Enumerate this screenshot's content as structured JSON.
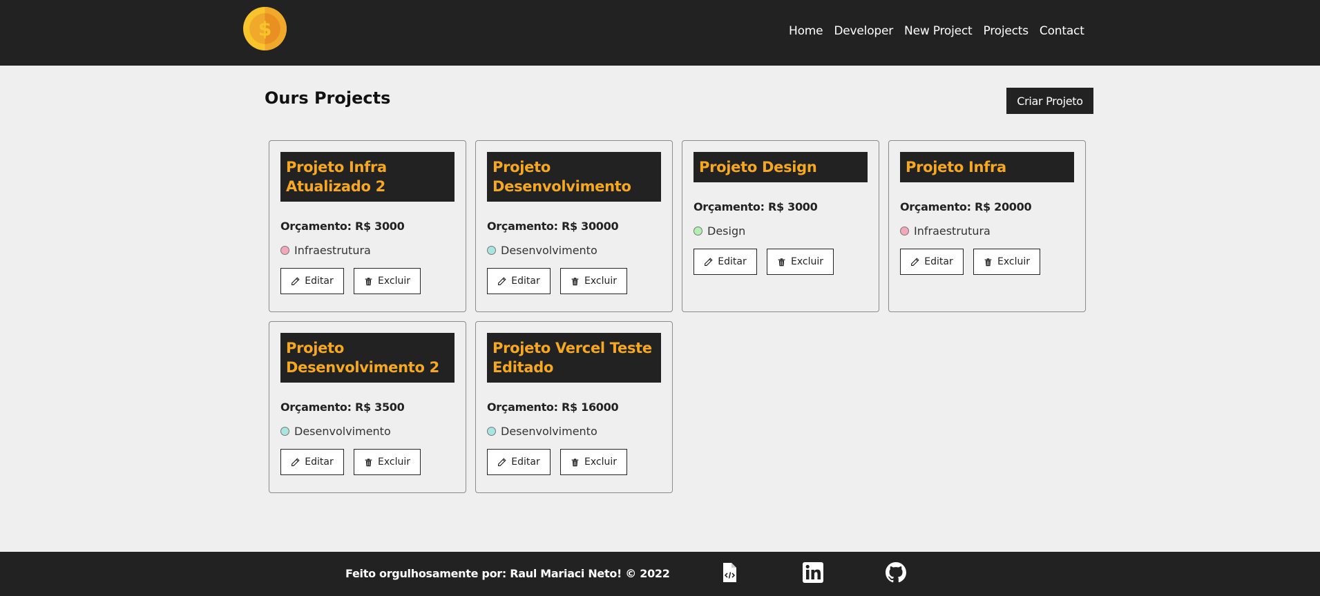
{
  "header": {
    "logo_icon": "coin-dollar-icon",
    "nav": [
      "Home",
      "Developer",
      "New Project",
      "Projects",
      "Contact"
    ]
  },
  "main": {
    "title": "Ours Projects",
    "create_button": "Criar Projeto"
  },
  "projects": [
    {
      "name": "Projeto Infra Atualizado 2",
      "budget": "Orçamento: R$ 3000",
      "category": "Infraestrutura",
      "category_color": "#f4a7b9"
    },
    {
      "name": "Projeto Desenvolvimento",
      "budget": "Orçamento: R$ 30000",
      "category": "Desenvolvimento",
      "category_color": "#a8e4e0"
    },
    {
      "name": "Projeto Design",
      "budget": "Orçamento: R$ 3000",
      "category": "Design",
      "category_color": "#b2efb2"
    },
    {
      "name": "Projeto Infra",
      "budget": "Orçamento: R$ 20000",
      "category": "Infraestrutura",
      "category_color": "#f4a7b9"
    },
    {
      "name": "Projeto Desenvolvimento 2",
      "budget": "Orçamento: R$ 3500",
      "category": "Desenvolvimento",
      "category_color": "#a8e4e0"
    },
    {
      "name": "Projeto Vercel Teste Editado",
      "budget": "Orçamento: R$ 16000",
      "category": "Desenvolvimento",
      "category_color": "#a8e4e0"
    }
  ],
  "card_actions": {
    "edit_label": "Editar",
    "delete_label": "Excluir",
    "edit_icon": "pencil-icon",
    "delete_icon": "trash-icon"
  },
  "footer": {
    "text": "Feito orgulhosamente por: Raul Mariaci Neto! © 2022",
    "icons": [
      "code-file-icon",
      "linkedin-icon",
      "github-icon"
    ]
  },
  "colors": {
    "dark": "#222222",
    "accent": "#f6a823",
    "background": "#efefef"
  }
}
